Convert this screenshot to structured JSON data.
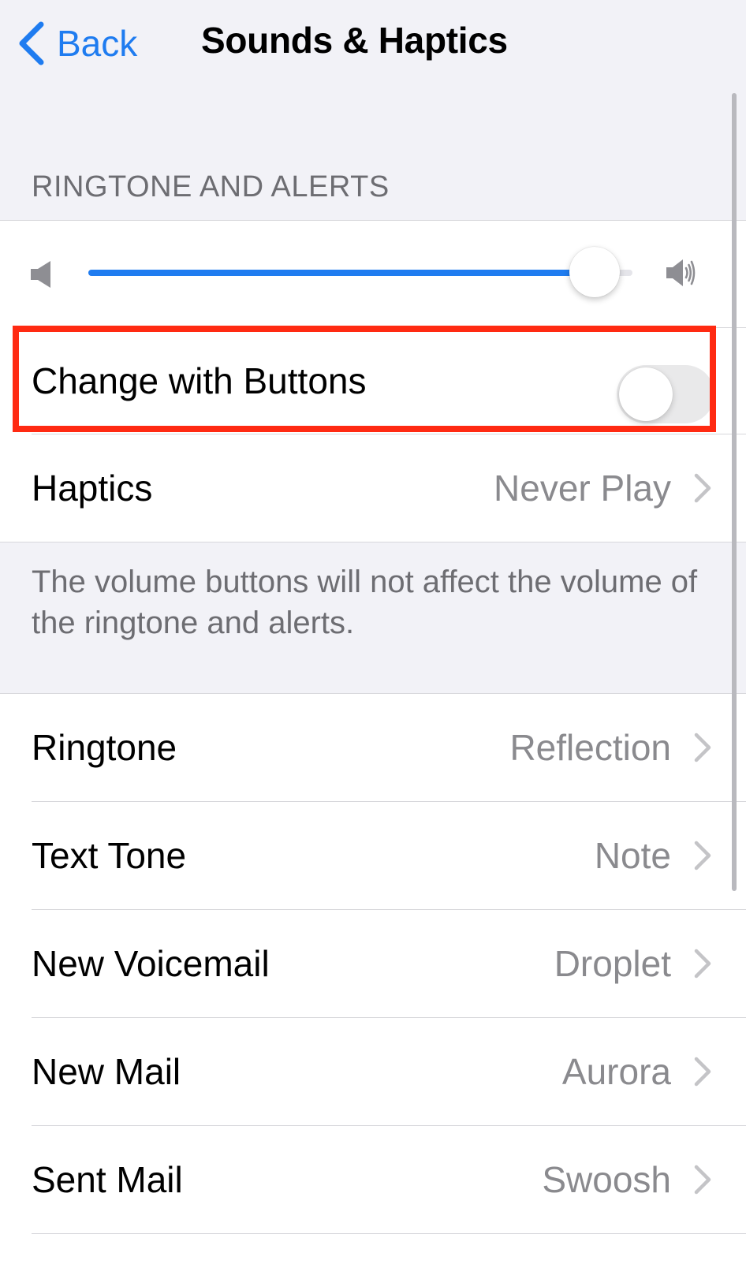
{
  "nav": {
    "back_label": "Back",
    "title": "Sounds & Haptics"
  },
  "section": {
    "header": "RINGTONE AND ALERTS"
  },
  "volume": {
    "level": 0.93
  },
  "change_with_buttons": {
    "label": "Change with Buttons",
    "enabled": false
  },
  "haptics": {
    "label": "Haptics",
    "value": "Never Play"
  },
  "footer": {
    "text": "The volume buttons will not affect the volume of the ringtone and alerts."
  },
  "tones": [
    {
      "label": "Ringtone",
      "value": "Reflection"
    },
    {
      "label": "Text Tone",
      "value": "Note"
    },
    {
      "label": "New Voicemail",
      "value": "Droplet"
    },
    {
      "label": "New Mail",
      "value": "Aurora"
    },
    {
      "label": "Sent Mail",
      "value": "Swoosh"
    }
  ],
  "colors": {
    "accent": "#1f7cf0",
    "highlight": "#ff2a12",
    "secondary_text": "#8a8a8e"
  },
  "icons": {
    "back": "chevron-left-icon",
    "volume_low": "speaker-low-icon",
    "volume_high": "speaker-high-icon",
    "disclosure": "chevron-right-icon"
  }
}
